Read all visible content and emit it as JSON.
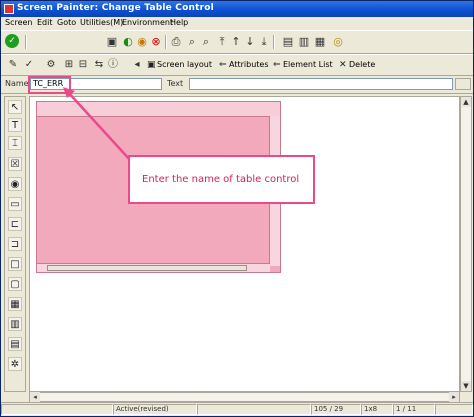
{
  "window": {
    "title": "Screen Painter: Change Table Control"
  },
  "menu": [
    "Screen",
    "Edit",
    "Goto",
    "Utilities(M)",
    "Environment",
    "Help"
  ],
  "toolbar2": {
    "layout": "Screen layout",
    "attributes": "Attributes",
    "element_list": "Element List",
    "delete": "Delete"
  },
  "namebar": {
    "name_label": "Name",
    "name_value": "TC_ERR",
    "text_label": "Text"
  },
  "callout": {
    "text": "Enter the name of table control"
  },
  "statusbar": {
    "mode": "Active(revised)",
    "pos": "105 / 29",
    "size": "1x8",
    "lines": "1 / 11"
  },
  "colors": {
    "highlight": "#e84a8a",
    "table_fill": "#f2a9bc",
    "title_bar": "#0b4fd0"
  }
}
